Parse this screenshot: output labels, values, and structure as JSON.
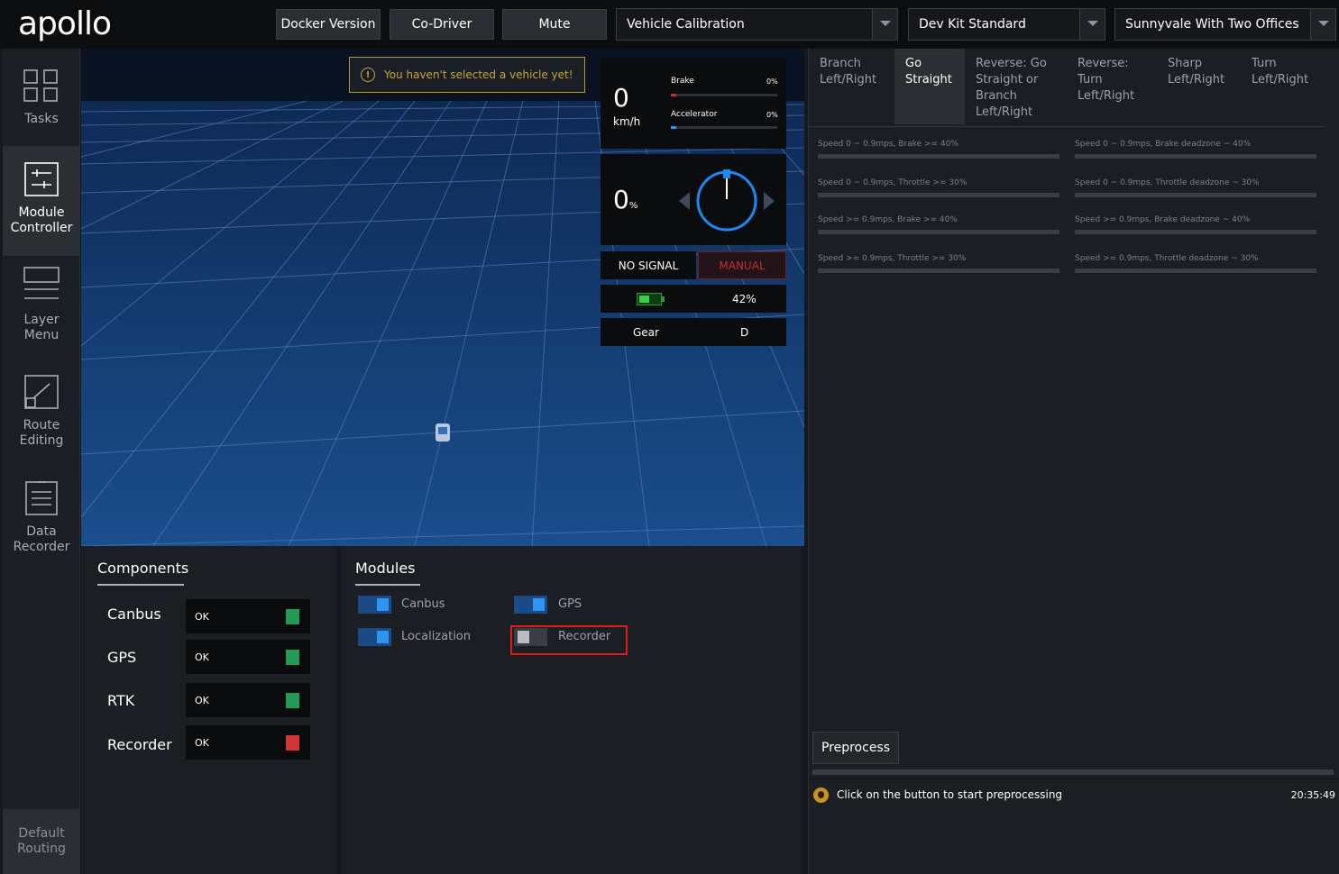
{
  "header": {
    "logo": "apollo",
    "buttons": [
      "Docker Version",
      "Co-Driver",
      "Mute"
    ],
    "selects": {
      "mode": "Vehicle Calibration",
      "vehicle": "Dev Kit Standard",
      "map": "Sunnyvale With Two Offices"
    }
  },
  "sidebar": {
    "items": [
      {
        "label": "Tasks",
        "icon": "grid-icon"
      },
      {
        "label": "Module Controller",
        "icon": "sliders-icon"
      },
      {
        "label": "Layer Menu",
        "icon": "layers-icon"
      },
      {
        "label": "Route Editing",
        "icon": "route-icon"
      },
      {
        "label": "Data Recorder",
        "icon": "document-icon"
      }
    ],
    "default_routing": "Default Routing"
  },
  "scene": {
    "warning": "You haven't selected a vehicle yet!"
  },
  "dashboard": {
    "speed": "0",
    "speed_unit": "km/h",
    "brake_label": "Brake",
    "brake_pct": "0%",
    "accel_label": "Accelerator",
    "accel_pct": "0%",
    "steering": "0",
    "steering_unit": "%",
    "signal": "NO SIGNAL",
    "drive_mode": "MANUAL",
    "battery_pct": "42%",
    "battery_level": 0.42,
    "gear_label": "Gear",
    "gear_value": "D"
  },
  "components": {
    "title": "Components",
    "items": [
      {
        "label": "Canbus",
        "status": "OK",
        "color": "#1f9d55"
      },
      {
        "label": "GPS",
        "status": "OK",
        "color": "#1f9d55"
      },
      {
        "label": "RTK",
        "status": "OK",
        "color": "#1f9d55"
      },
      {
        "label": "Recorder",
        "status": "OK",
        "color": "#d23333"
      }
    ]
  },
  "modules": {
    "title": "Modules",
    "items": [
      {
        "label": "Canbus",
        "on": true
      },
      {
        "label": "GPS",
        "on": true
      },
      {
        "label": "Localization",
        "on": true
      },
      {
        "label": "Recorder",
        "on": false
      }
    ]
  },
  "calibration": {
    "tabs": [
      "Branch Left/Right",
      "Go Straight",
      "Reverse: Go Straight or Branch Left/Right",
      "Reverse: Turn Left/Right",
      "Sharp Left/Right",
      "Turn Left/Right"
    ],
    "active_tab": "Go Straight",
    "items": [
      "Speed 0 ~ 0.9mps, Brake >= 40%",
      "Speed 0 ~ 0.9mps, Brake deadzone ~ 40%",
      "Speed 0 ~ 0.9mps, Throttle >= 30%",
      "Speed 0 ~ 0.9mps, Throttle deadzone ~ 30%",
      "Speed >= 0.9mps, Brake >= 40%",
      "Speed >= 0.9mps, Brake deadzone ~ 40%",
      "Speed >= 0.9mps, Throttle >= 30%",
      "Speed >= 0.9mps, Throttle deadzone ~ 30%"
    ],
    "preprocess_button": "Preprocess",
    "message": "Click on the button to start preprocessing",
    "time": "20:35:49"
  }
}
